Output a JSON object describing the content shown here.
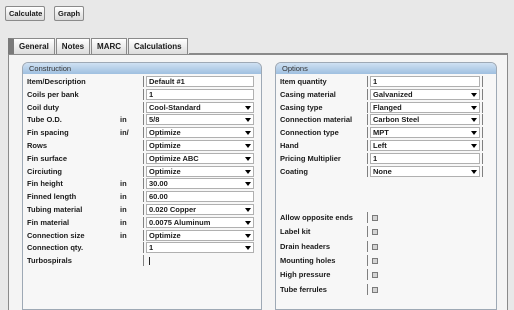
{
  "toolbar": {
    "calculate": "Calculate",
    "graph": "Graph"
  },
  "tabs": [
    "General",
    "Notes",
    "MARC",
    "Calculations"
  ],
  "construction": {
    "title": "Construction",
    "rows": [
      {
        "label": "Item/Description",
        "unit": "",
        "value": "Default #1",
        "dropdown": false
      },
      {
        "label": "Coils per bank",
        "unit": "",
        "value": "1",
        "dropdown": false
      },
      {
        "label": "Coil duty",
        "unit": "",
        "value": "Cool-Standard",
        "dropdown": true
      },
      {
        "label": "Tube O.D.",
        "unit": "in",
        "value": "5/8",
        "dropdown": true
      },
      {
        "label": "Fin spacing",
        "unit": "in/",
        "value": "Optimize",
        "dropdown": true
      },
      {
        "label": "Rows",
        "unit": "",
        "value": "Optimize",
        "dropdown": true
      },
      {
        "label": "Fin surface",
        "unit": "",
        "value": "Optimize ABC",
        "dropdown": true
      },
      {
        "label": "Circiuting",
        "unit": "",
        "value": "Optimize",
        "dropdown": true
      },
      {
        "label": "Fin height",
        "unit": "in",
        "value": "30.00",
        "dropdown": true
      },
      {
        "label": "Finned length",
        "unit": "in",
        "value": "60.00",
        "dropdown": false
      },
      {
        "label": "Tubing material",
        "unit": "in",
        "value": "0.020 Copper",
        "dropdown": true
      },
      {
        "label": "Fin material",
        "unit": "in",
        "value": "0.0075 Aluminum",
        "dropdown": true
      },
      {
        "label": "Connection size",
        "unit": "in",
        "value": "Optimize",
        "dropdown": true
      },
      {
        "label": "Connection qty.",
        "unit": "",
        "value": "1",
        "dropdown": true
      },
      {
        "label": "Turbospirals",
        "unit": "",
        "value": "",
        "dropdown": false,
        "checkbox": true
      }
    ]
  },
  "options": {
    "title": "Options",
    "rows": [
      {
        "label": "Item quantity",
        "value": "1",
        "dropdown": false
      },
      {
        "label": "Casing material",
        "value": "Galvanized",
        "dropdown": true
      },
      {
        "label": "Casing type",
        "value": "Flanged",
        "dropdown": true
      },
      {
        "label": "Connection material",
        "value": "Carbon Steel",
        "dropdown": true
      },
      {
        "label": "Connection type",
        "value": "MPT",
        "dropdown": true
      },
      {
        "label": "Hand",
        "value": "Left",
        "dropdown": true
      },
      {
        "label": "Pricing Multiplier",
        "value": "1",
        "dropdown": false
      },
      {
        "label": "Coating",
        "value": "None",
        "dropdown": true
      }
    ],
    "checks": [
      {
        "label": "Allow opposite ends"
      },
      {
        "label": "Label kit"
      },
      {
        "label": "Drain headers"
      },
      {
        "label": "Mounting holes"
      },
      {
        "label": "High pressure"
      },
      {
        "label": "Tube ferrules"
      }
    ]
  }
}
